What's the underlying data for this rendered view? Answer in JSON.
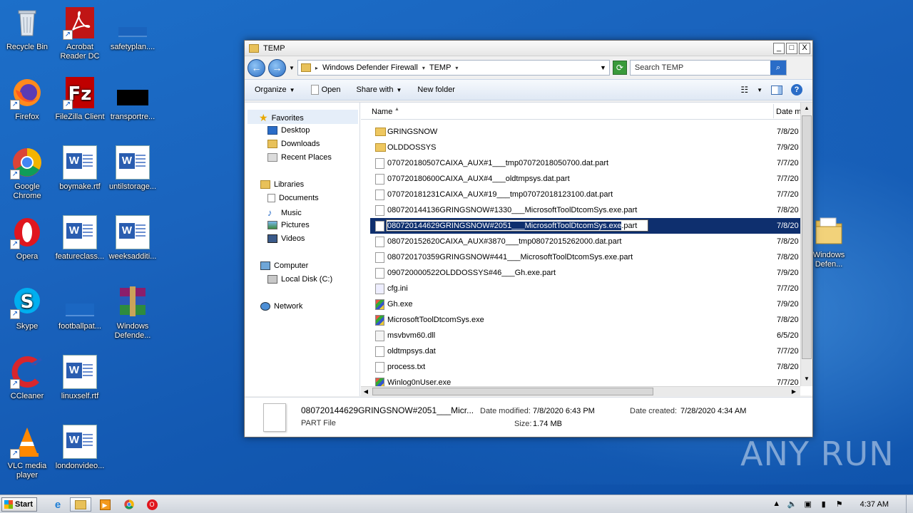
{
  "desktop": {
    "icons": [
      {
        "label": "Recycle Bin"
      },
      {
        "label": "Acrobat Reader DC"
      },
      {
        "label": "safetyplan...."
      },
      {
        "label": "Firefox"
      },
      {
        "label": "FileZilla Client"
      },
      {
        "label": "transportre..."
      },
      {
        "label": "Google Chrome"
      },
      {
        "label": "boymake.rtf"
      },
      {
        "label": "untilstorage..."
      },
      {
        "label": "Opera"
      },
      {
        "label": "featureclass..."
      },
      {
        "label": "weeksadditi..."
      },
      {
        "label": "Skype"
      },
      {
        "label": "footballpat..."
      },
      {
        "label": "Windows Defende..."
      },
      {
        "label": "CCleaner"
      },
      {
        "label": "linuxself.rtf"
      },
      {
        "label": "VLC media player"
      },
      {
        "label": "londonvideo..."
      },
      {
        "label": "Windows Defen..."
      }
    ]
  },
  "window": {
    "title": "TEMP",
    "buttons": {
      "minimize": "_",
      "maximize": "□",
      "close": "X"
    },
    "breadcrumb": [
      "Windows Defender Firewall",
      "TEMP"
    ],
    "search_placeholder": "Search TEMP",
    "toolbar": {
      "organize": "Organize",
      "open": "Open",
      "share_with": "Share with",
      "new_folder": "New folder"
    },
    "nav": {
      "favorites": "Favorites",
      "desktop": "Desktop",
      "downloads": "Downloads",
      "recent_places": "Recent Places",
      "libraries": "Libraries",
      "documents": "Documents",
      "music": "Music",
      "pictures": "Pictures",
      "videos": "Videos",
      "computer": "Computer",
      "local_disk": "Local Disk (C:)",
      "network": "Network"
    },
    "columns": {
      "name": "Name",
      "date": "Date m"
    },
    "files": [
      {
        "name": "GRINGSNOW",
        "date": "7/8/20",
        "icon": "folder-icon"
      },
      {
        "name": "OLDDOSSYS",
        "date": "7/9/20",
        "icon": "folder-icon"
      },
      {
        "name": "070720180507CAIXA_AUX#1___tmp07072018050700.dat.part",
        "date": "7/7/20",
        "icon": "file-icon"
      },
      {
        "name": "070720180600CAIXA_AUX#4___oldtmpsys.dat.part",
        "date": "7/7/20",
        "icon": "file-icon"
      },
      {
        "name": "070720181231CAIXA_AUX#19___tmp07072018123100.dat.part",
        "date": "7/7/20",
        "icon": "file-icon"
      },
      {
        "name": "080720144136GRINGSNOW#1330___MicrosoftToolDtcomSys.exe.part",
        "date": "7/8/20",
        "icon": "file-icon"
      },
      {
        "name_selected": "080720144629GRINGSNOW#2051___MicrosoftToolDtcomSys.exe",
        "name_rest": ".part",
        "date": "7/8/20",
        "icon": "file-icon",
        "selected": true
      },
      {
        "name": "080720152620CAIXA_AUX#3870___tmp08072015262000.dat.part",
        "date": "7/8/20",
        "icon": "file-icon"
      },
      {
        "name": "080720170359GRINGSNOW#441___MicrosoftToolDtcomSys.exe.part",
        "date": "7/8/20",
        "icon": "file-icon"
      },
      {
        "name": "090720000522OLDDOSSYS#46___Gh.exe.part",
        "date": "7/9/20",
        "icon": "file-icon"
      },
      {
        "name": "cfg.ini",
        "date": "7/7/20",
        "icon": "ini-icon"
      },
      {
        "name": "Gh.exe",
        "date": "7/9/20",
        "icon": "exe-icon"
      },
      {
        "name": "MicrosoftToolDtcomSys.exe",
        "date": "7/8/20",
        "icon": "exe-icon"
      },
      {
        "name": "msvbvm60.dll",
        "date": "6/5/20",
        "icon": "dll-icon"
      },
      {
        "name": "oldtmpsys.dat",
        "date": "7/7/20",
        "icon": "file-icon"
      },
      {
        "name": "process.txt",
        "date": "7/8/20",
        "icon": "file-icon"
      },
      {
        "name": "Winlog0nUser.exe",
        "date": "7/7/20",
        "icon": "exe-icon"
      }
    ],
    "details": {
      "filename": "080720144629GRINGSNOW#2051___Micr...",
      "type": "PART File",
      "date_modified_label": "Date modified:",
      "date_modified": "7/8/2020 6:43 PM",
      "size_label": "Size:",
      "size": "1.74 MB",
      "date_created_label": "Date created:",
      "date_created": "7/28/2020 4:34 AM"
    }
  },
  "taskbar": {
    "start": "Start",
    "clock": "4:37 AM"
  },
  "watermark": "ANY RUN"
}
